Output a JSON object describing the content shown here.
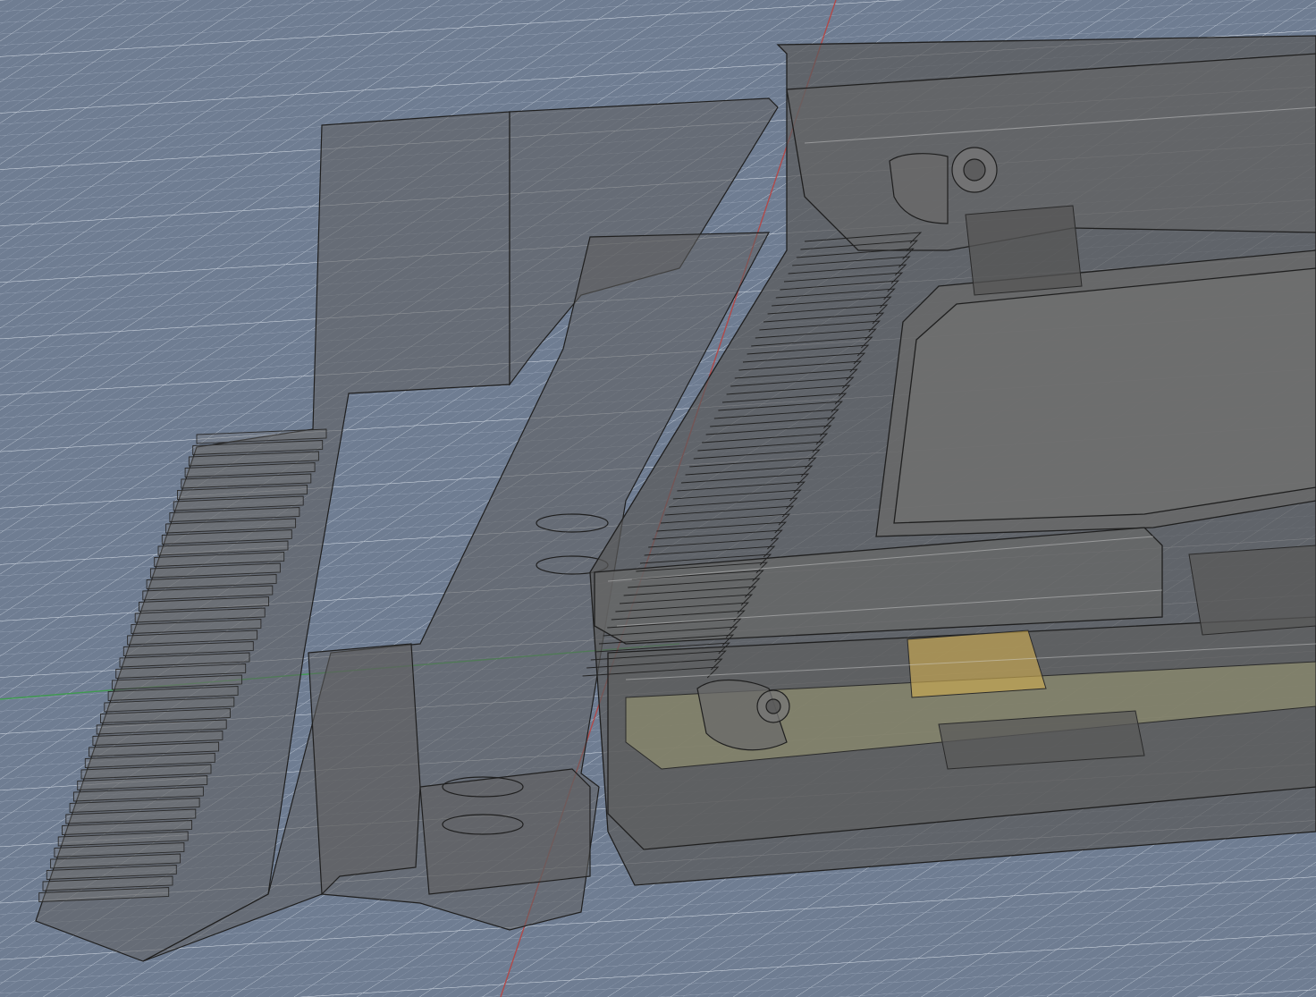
{
  "viewport": {
    "background_color": "#6f7d92",
    "grid_minor_color": "#9aa6b8",
    "grid_major_color": "#c9d1dc",
    "x_axis_color": "#b04a4a",
    "y_axis_color": "#3f9a4f",
    "body_fill_color": "#5f5f5f",
    "edge_color": "#1f1f1f",
    "pcb_color": "#9c9a72",
    "component_color": "#c9a952"
  },
  "objects": [
    {
      "name": "bracket-body",
      "kind": "transparent-solid"
    },
    {
      "name": "enclosure-lid",
      "kind": "transparent-solid"
    },
    {
      "name": "fin-array",
      "kind": "heatsink-fins"
    },
    {
      "name": "pcb-board",
      "kind": "circuit-board"
    }
  ]
}
